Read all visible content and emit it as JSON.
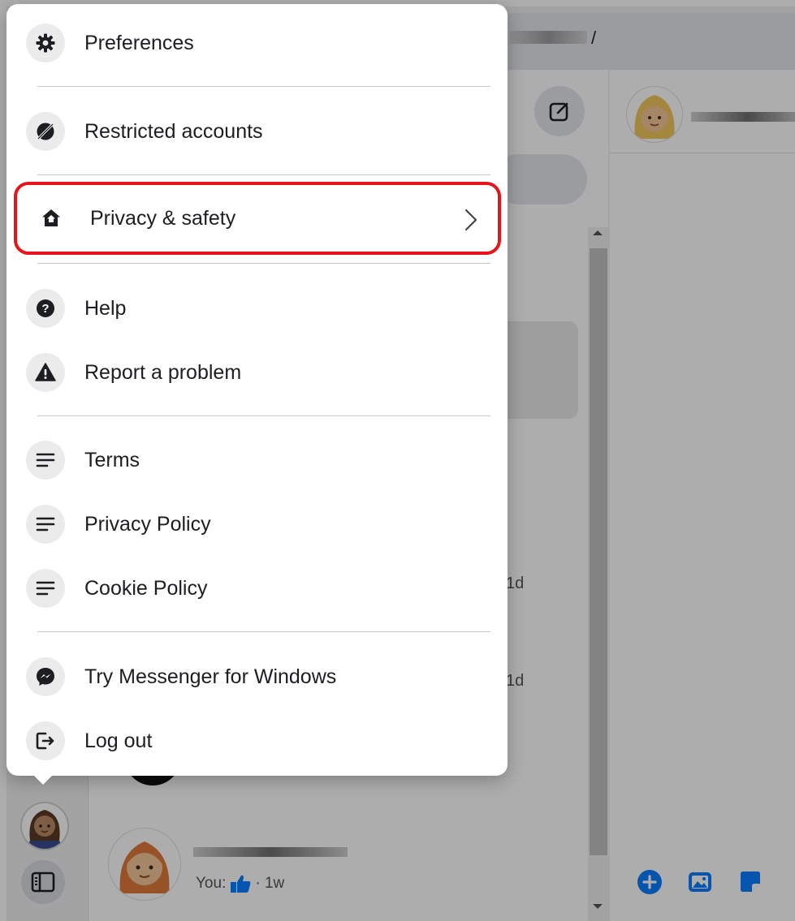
{
  "header": {
    "url_suffix": "/"
  },
  "chat_list": {
    "times": [
      "1d",
      "1d"
    ],
    "last_chat": {
      "preview_prefix": "You:",
      "preview_suffix": "· 1w"
    }
  },
  "menu": {
    "items": [
      {
        "label": "Preferences",
        "icon": "gear-icon"
      },
      {
        "label": "Restricted accounts",
        "icon": "restricted-icon"
      },
      {
        "label": "Privacy & safety",
        "icon": "home-shield-icon",
        "highlighted": true
      },
      {
        "label": "Help",
        "icon": "question-icon"
      },
      {
        "label": "Report a problem",
        "icon": "warning-icon"
      },
      {
        "label": "Terms",
        "icon": "lines-icon"
      },
      {
        "label": "Privacy Policy",
        "icon": "lines-icon"
      },
      {
        "label": "Cookie Policy",
        "icon": "lines-icon"
      },
      {
        "label": "Try Messenger for Windows",
        "icon": "messenger-icon"
      },
      {
        "label": "Log out",
        "icon": "logout-icon"
      }
    ]
  },
  "colors": {
    "highlight": "#e8141b",
    "accent": "#0a7cff"
  }
}
